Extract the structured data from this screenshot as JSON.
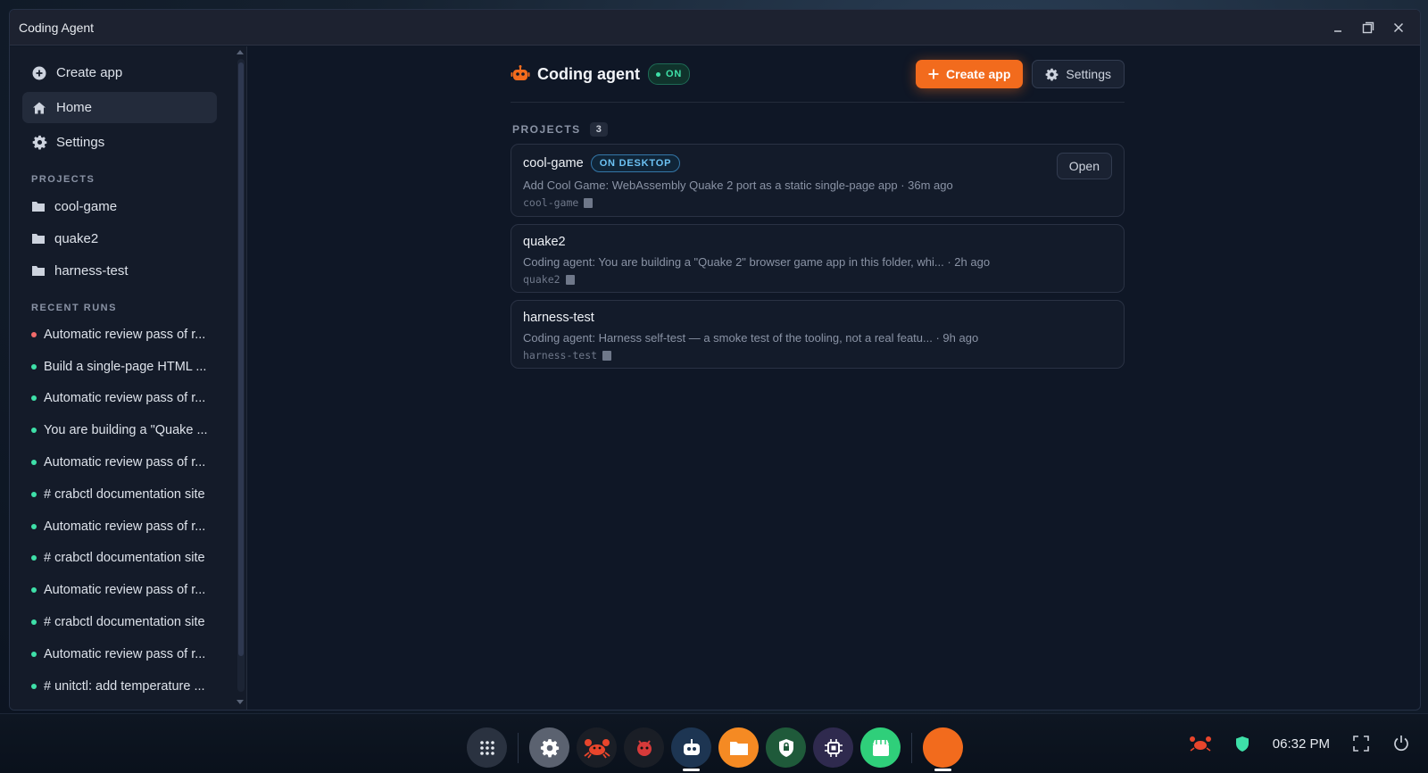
{
  "window": {
    "title": "Coding Agent"
  },
  "sidebar": {
    "nav": [
      {
        "label": "Create app",
        "icon": "plus-circle-icon"
      },
      {
        "label": "Home",
        "icon": "home-icon"
      },
      {
        "label": "Settings",
        "icon": "gear-icon"
      }
    ],
    "projects_label": "PROJECTS",
    "projects": [
      "cool-game",
      "quake2",
      "harness-test"
    ],
    "recent_runs_label": "RECENT RUNS",
    "recent_runs": [
      {
        "label": "Automatic review pass of r...",
        "status_color": "#f26b6b"
      },
      {
        "label": "Build a single-page HTML ...",
        "status_color": "#3ee0a8"
      },
      {
        "label": "Automatic review pass of r...",
        "status_color": "#3ee0a8"
      },
      {
        "label": "You are building a \"Quake ...",
        "status_color": "#3ee0a8"
      },
      {
        "label": "Automatic review pass of r...",
        "status_color": "#3ee0a8"
      },
      {
        "label": "# crabctl documentation site",
        "status_color": "#3ee0a8"
      },
      {
        "label": "Automatic review pass of r...",
        "status_color": "#3ee0a8"
      },
      {
        "label": "# crabctl documentation site",
        "status_color": "#3ee0a8"
      },
      {
        "label": "Automatic review pass of r...",
        "status_color": "#3ee0a8"
      },
      {
        "label": "# crabctl documentation site",
        "status_color": "#3ee0a8"
      },
      {
        "label": "Automatic review pass of r...",
        "status_color": "#3ee0a8"
      },
      {
        "label": "# unitctl: add temperature ...",
        "status_color": "#3ee0a8"
      }
    ]
  },
  "header": {
    "title": "Coding agent",
    "status": "ON",
    "create_button": "Create app",
    "settings_button": "Settings"
  },
  "projects_section": {
    "label": "PROJECTS",
    "count": "3",
    "items": [
      {
        "name": "cool-game",
        "badge": "ON DESKTOP",
        "description": "Add Cool Game: WebAssembly Quake 2 port as a static single-page app · 36m ago",
        "path": "cool-game",
        "action": "Open"
      },
      {
        "name": "quake2",
        "description": "Coding agent: You are building a \"Quake 2\" browser game app in this folder, whi... · 2h ago",
        "path": "quake2"
      },
      {
        "name": "harness-test",
        "description": "Coding agent: Harness self-test — a smoke test of the tooling, not a real featu... · 9h ago",
        "path": "harness-test"
      }
    ]
  },
  "taskbar": {
    "apps": [
      {
        "name": "app-launcher-icon",
        "bg": "#2a3240"
      },
      {
        "name": "settings-app-icon",
        "bg": "#5b6270"
      },
      {
        "name": "crab-app-icon",
        "bg": "#1a1e26"
      },
      {
        "name": "bug-app-icon",
        "bg": "#1a1e26"
      },
      {
        "name": "robot-app-icon",
        "bg": "#1d3552"
      },
      {
        "name": "files-app-icon",
        "bg": "#f58a23"
      },
      {
        "name": "shield-app-icon",
        "bg": "#1f5a3a"
      },
      {
        "name": "chip-app-icon",
        "bg": "#2f2a4e"
      },
      {
        "name": "store-app-icon",
        "bg": "#2fcf7a"
      },
      {
        "name": "orange-app-icon",
        "bg": "#f26b1d"
      }
    ],
    "clock": "06:32 PM"
  },
  "colors": {
    "accent": "#f26b1d",
    "on_green": "#3ee0a8",
    "desktop_blue": "#6cc2f3"
  }
}
